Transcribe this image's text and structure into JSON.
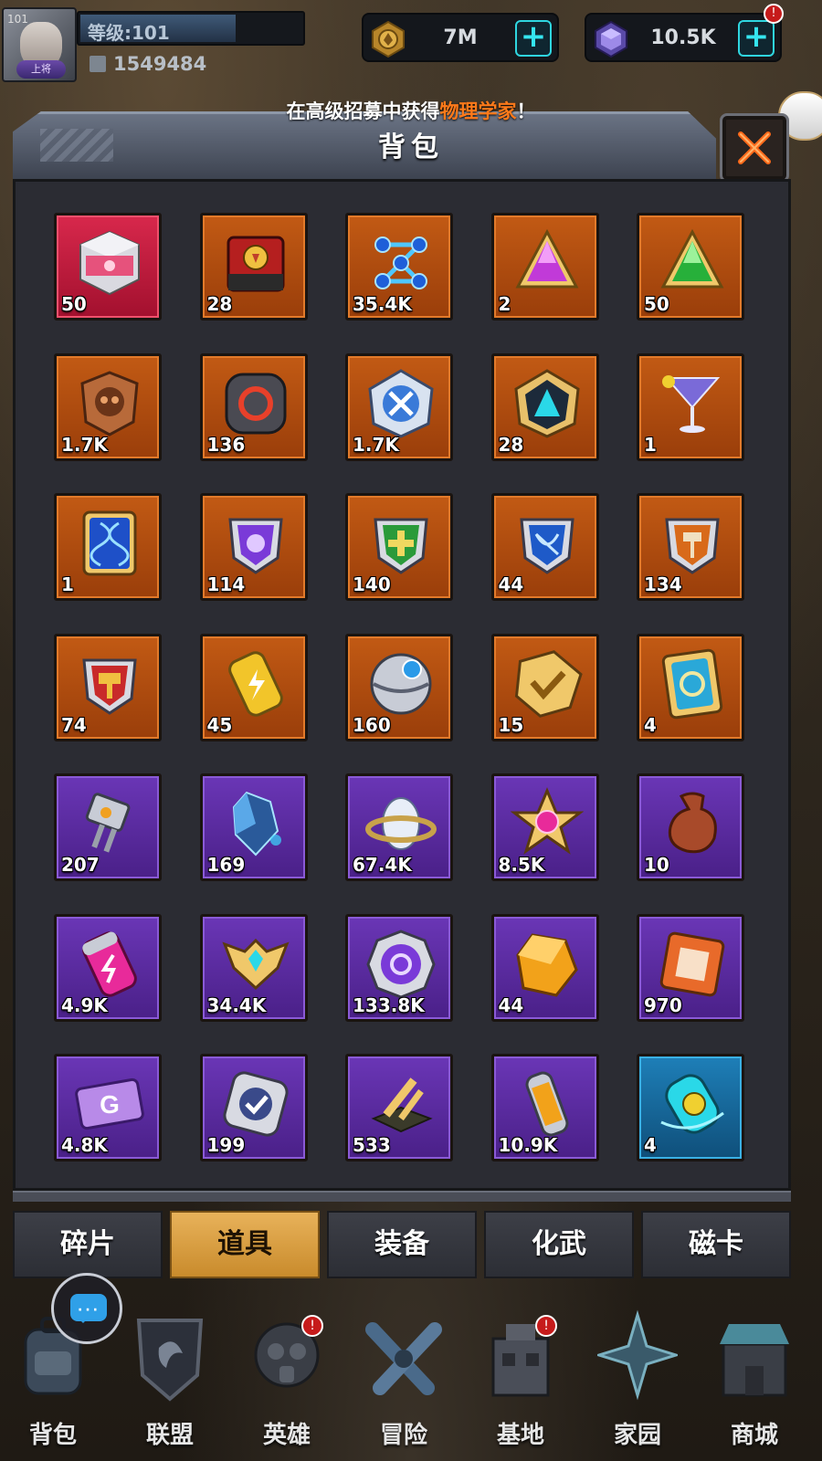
{
  "player": {
    "avatar_level": "101",
    "rank": "上将",
    "level_text": "等级:101",
    "power": "1549484"
  },
  "resources": [
    {
      "name": "gold-coin-icon",
      "value": "7M"
    },
    {
      "name": "gem-icon",
      "value": "10.5K",
      "badge": "!"
    }
  ],
  "notice": {
    "prefix": "在高级招募中获得",
    "highlight": "物理学家",
    "suffix": "！"
  },
  "panel": {
    "title": "背包"
  },
  "items": [
    {
      "icon": "red-cube-chest-icon",
      "rarity": "red",
      "count": "50"
    },
    {
      "icon": "red-supply-crate-icon",
      "rarity": "orange",
      "count": "28"
    },
    {
      "icon": "blue-molecule-icon",
      "rarity": "orange",
      "count": "35.4K"
    },
    {
      "icon": "purple-triangle-gem-icon",
      "rarity": "orange",
      "count": "2"
    },
    {
      "icon": "green-triangle-gem-icon",
      "rarity": "orange",
      "count": "50"
    },
    {
      "icon": "skull-badge-icon",
      "rarity": "orange",
      "count": "1.7K"
    },
    {
      "icon": "dark-ring-token-icon",
      "rarity": "orange",
      "count": "136"
    },
    {
      "icon": "crossed-swords-token-icon",
      "rarity": "orange",
      "count": "1.7K"
    },
    {
      "icon": "blue-pyramid-token-icon",
      "rarity": "orange",
      "count": "28"
    },
    {
      "icon": "cocktail-glass-icon",
      "rarity": "orange",
      "count": "1"
    },
    {
      "icon": "dna-card-icon",
      "rarity": "orange",
      "count": "1"
    },
    {
      "icon": "purple-crest-badge-icon",
      "rarity": "orange",
      "count": "114"
    },
    {
      "icon": "green-cross-badge-icon",
      "rarity": "orange",
      "count": "140"
    },
    {
      "icon": "blue-bow-badge-icon",
      "rarity": "orange",
      "count": "44"
    },
    {
      "icon": "orange-hammer-badge-icon",
      "rarity": "orange",
      "count": "134"
    },
    {
      "icon": "red-hammer-badge-icon",
      "rarity": "orange",
      "count": "74"
    },
    {
      "icon": "energy-can-icon",
      "rarity": "orange",
      "count": "45"
    },
    {
      "icon": "metal-orb-icon",
      "rarity": "orange",
      "count": "160"
    },
    {
      "icon": "gold-check-token-icon",
      "rarity": "orange",
      "count": "15"
    },
    {
      "icon": "gold-target-card-icon",
      "rarity": "orange",
      "count": "4"
    },
    {
      "icon": "plug-module-icon",
      "rarity": "purple",
      "count": "207"
    },
    {
      "icon": "blue-crystal-shard-icon",
      "rarity": "purple",
      "count": "169"
    },
    {
      "icon": "ringed-egg-icon",
      "rarity": "purple",
      "count": "67.4K"
    },
    {
      "icon": "pink-star-gem-icon",
      "rarity": "purple",
      "count": "8.5K"
    },
    {
      "icon": "brown-sack-icon",
      "rarity": "purple",
      "count": "10"
    },
    {
      "icon": "pink-energy-can-icon",
      "rarity": "purple",
      "count": "4.9K"
    },
    {
      "icon": "winged-crest-icon",
      "rarity": "purple",
      "count": "34.4K"
    },
    {
      "icon": "purple-gear-coin-icon",
      "rarity": "purple",
      "count": "133.8K"
    },
    {
      "icon": "gold-ore-icon",
      "rarity": "purple",
      "count": "44"
    },
    {
      "icon": "orange-frame-tile-icon",
      "rarity": "purple",
      "count": "970"
    },
    {
      "icon": "g-ticket-icon",
      "rarity": "purple",
      "count": "4.8K"
    },
    {
      "icon": "silver-check-token-icon",
      "rarity": "purple",
      "count": "199"
    },
    {
      "icon": "gold-sword-base-icon",
      "rarity": "purple",
      "count": "533"
    },
    {
      "icon": "orange-tube-canister-icon",
      "rarity": "purple",
      "count": "10.9K"
    },
    {
      "icon": "cyan-capsule-icon",
      "rarity": "blue",
      "count": "4"
    }
  ],
  "tabs": [
    {
      "label": "碎片",
      "active": false
    },
    {
      "label": "道具",
      "active": true
    },
    {
      "label": "装备",
      "active": false
    },
    {
      "label": "化武",
      "active": false
    },
    {
      "label": "磁卡",
      "active": false
    }
  ],
  "nav": [
    {
      "icon": "backpack-icon",
      "label": "背包"
    },
    {
      "icon": "alliance-shield-icon",
      "label": "联盟"
    },
    {
      "icon": "gas-mask-hero-icon",
      "label": "英雄",
      "badge": "!"
    },
    {
      "icon": "crossed-guns-icon",
      "label": "冒险"
    },
    {
      "icon": "base-building-icon",
      "label": "基地",
      "badge": "!"
    },
    {
      "icon": "home-star-icon",
      "label": "家园"
    },
    {
      "icon": "shop-store-icon",
      "label": "商城"
    }
  ],
  "colors": {
    "orange_slot": "#c25a14",
    "purple_slot": "#6a36b6",
    "red_slot": "#d8284c",
    "blue_slot": "#1e7fb8",
    "active_tab": "#e8b25a",
    "notice_highlight": "#ff7a1a",
    "plus_accent": "#35e6f0"
  }
}
